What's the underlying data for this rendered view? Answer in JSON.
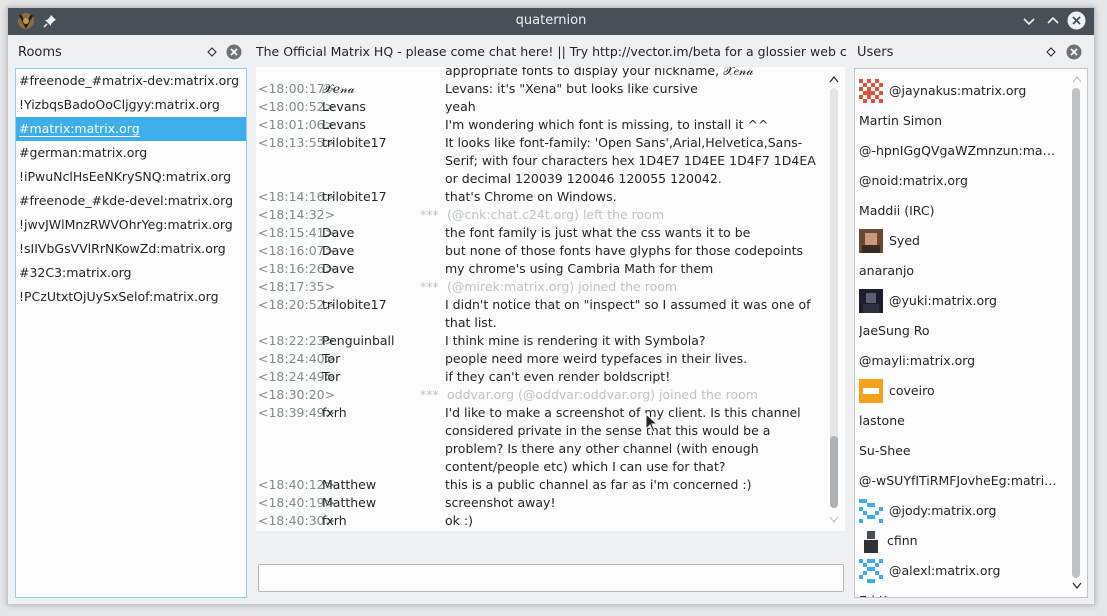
{
  "window": {
    "title": "quaternion"
  },
  "rooms": {
    "header": "Rooms",
    "items": [
      {
        "label": "#freenode_#matrix-dev:matrix.org",
        "selected": false
      },
      {
        "label": "!YizbqsBadoOoCljgyy:matrix.org",
        "selected": false
      },
      {
        "label": "#matrix:matrix.org",
        "selected": true
      },
      {
        "label": "#german:matrix.org",
        "selected": false
      },
      {
        "label": "!iPwuNclHsEeNKrySNQ:matrix.org",
        "selected": false
      },
      {
        "label": "#freenode_#kde-devel:matrix.org",
        "selected": false
      },
      {
        "label": "!jwvJWlMnzRWVOhrYeg:matrix.org",
        "selected": false
      },
      {
        "label": "!sIIVbGsVVlRrNKowZd:matrix.org",
        "selected": false
      },
      {
        "label": "#32C3:matrix.org",
        "selected": false
      },
      {
        "label": "!PCzUtxtOjUySxSelof:matrix.org",
        "selected": false
      }
    ]
  },
  "room": {
    "topic": "The Official Matrix HQ - please come chat here! || Try http://vector.im/beta for a glossier web client"
  },
  "timeline": [
    {
      "time": "",
      "author": "",
      "text": "appropriate fonts to display your nickname, 𝒳𝑒𝓃𝒶",
      "lines": 1
    },
    {
      "time": "<18:00:17>",
      "author": "𝒳𝑒𝓃𝒶",
      "text": "Levans: it's \"Xena\" but looks like cursive",
      "lines": 1
    },
    {
      "time": "<18:00:52>",
      "author": "Levans",
      "text": "yeah",
      "lines": 1
    },
    {
      "time": "<18:01:06>",
      "author": "Levans",
      "text": "I'm wondering which font is missing, to install it ^^",
      "lines": 1
    },
    {
      "time": "<18:13:55>",
      "author": "trilobite17",
      "text": "It looks like font-family: 'Open Sans',Arial,Helvetica,Sans-Serif; with four characters hex 1D4E7 1D4EE 1D4F7 1D4EA or decimal 120039 120046 120055 120042.",
      "lines": 3
    },
    {
      "time": "<18:14:16>",
      "author": "trilobite17",
      "text": "that's Chrome on Windows.",
      "lines": 1
    },
    {
      "time": "<18:14:32>",
      "author": "***",
      "text": "(@cnk:chat.c24t.org) left the room",
      "lines": 1,
      "system": true
    },
    {
      "time": "<18:15:41>",
      "author": "Dave",
      "text": "the font family is just what the css wants it to be",
      "lines": 1
    },
    {
      "time": "<18:16:07>",
      "author": "Dave",
      "text": "but none of those fonts have glyphs for those codepoints",
      "lines": 1
    },
    {
      "time": "<18:16:26>",
      "author": "Dave",
      "text": "my chrome's using Cambria Math for them",
      "lines": 1
    },
    {
      "time": "<18:17:35>",
      "author": "***",
      "text": "(@mirek:matrix.org) joined the room",
      "lines": 1,
      "system": true
    },
    {
      "time": "<18:20:52>",
      "author": "trilobite17",
      "text": "I didn't notice that on \"inspect\" so I assumed it was one of that list.",
      "lines": 2
    },
    {
      "time": "<18:22:23>",
      "author": "Penguinball",
      "text": "I think mine is rendering it with Symbola?",
      "lines": 1
    },
    {
      "time": "<18:24:40>",
      "author": "Tor",
      "text": "people need more weird typefaces in their lives.",
      "lines": 1
    },
    {
      "time": "<18:24:49>",
      "author": "Tor",
      "text": "if they can't even render boldscript!",
      "lines": 1
    },
    {
      "time": "<18:30:20>",
      "author": "***",
      "text": "oddvar.org (@oddvar:oddvar.org) joined the room",
      "lines": 1,
      "system": true
    },
    {
      "time": "<18:39:49>",
      "author": "fxrh",
      "text": "I'd like to make a screenshot of my client. Is this channel considered private in the sense that this would be a problem? Is there any other channel (with enough content/people etc) which I can use for that?",
      "lines": 4
    },
    {
      "time": "<18:40:12>",
      "author": "Matthew",
      "text": "this is a public channel as far as i'm concerned :)",
      "lines": 1
    },
    {
      "time": "<18:40:19>",
      "author": "Matthew",
      "text": "screenshot away!",
      "lines": 1
    },
    {
      "time": "<18:40:30>",
      "author": "fxrh",
      "text": "ok :)",
      "lines": 1
    }
  ],
  "composer": {
    "value": ""
  },
  "users": {
    "header": "Users",
    "items": [
      {
        "name": "@jaynakus:matrix.org",
        "avatar": "red-checker"
      },
      {
        "name": "Martin Simon",
        "avatar": "none"
      },
      {
        "name": "@-hpnIGgQVgaWZmnzun:mat...",
        "avatar": "none"
      },
      {
        "name": "@noid:matrix.org",
        "avatar": "none"
      },
      {
        "name": "Maddii (IRC)",
        "avatar": "none"
      },
      {
        "name": "Syed",
        "avatar": "photo-brown"
      },
      {
        "name": "anaranjo",
        "avatar": "none"
      },
      {
        "name": "@yuki:matrix.org",
        "avatar": "photo-dark"
      },
      {
        "name": "JaeSung Ro",
        "avatar": "none"
      },
      {
        "name": "@mayli:matrix.org",
        "avatar": "none"
      },
      {
        "name": "coveiro",
        "avatar": "orange-square"
      },
      {
        "name": "lastone",
        "avatar": "none"
      },
      {
        "name": "Su-Shee",
        "avatar": "none"
      },
      {
        "name": "@-wSUYfITiRMFJovheEg:matrix....",
        "avatar": "none"
      },
      {
        "name": "@jody:matrix.org",
        "avatar": "blue-pattern"
      },
      {
        "name": "cfinn",
        "avatar": "photo-person"
      },
      {
        "name": "@alexl:matrix.org",
        "avatar": "blue-pattern-2"
      },
      {
        "name": "Ed Kar",
        "avatar": "none"
      }
    ]
  }
}
